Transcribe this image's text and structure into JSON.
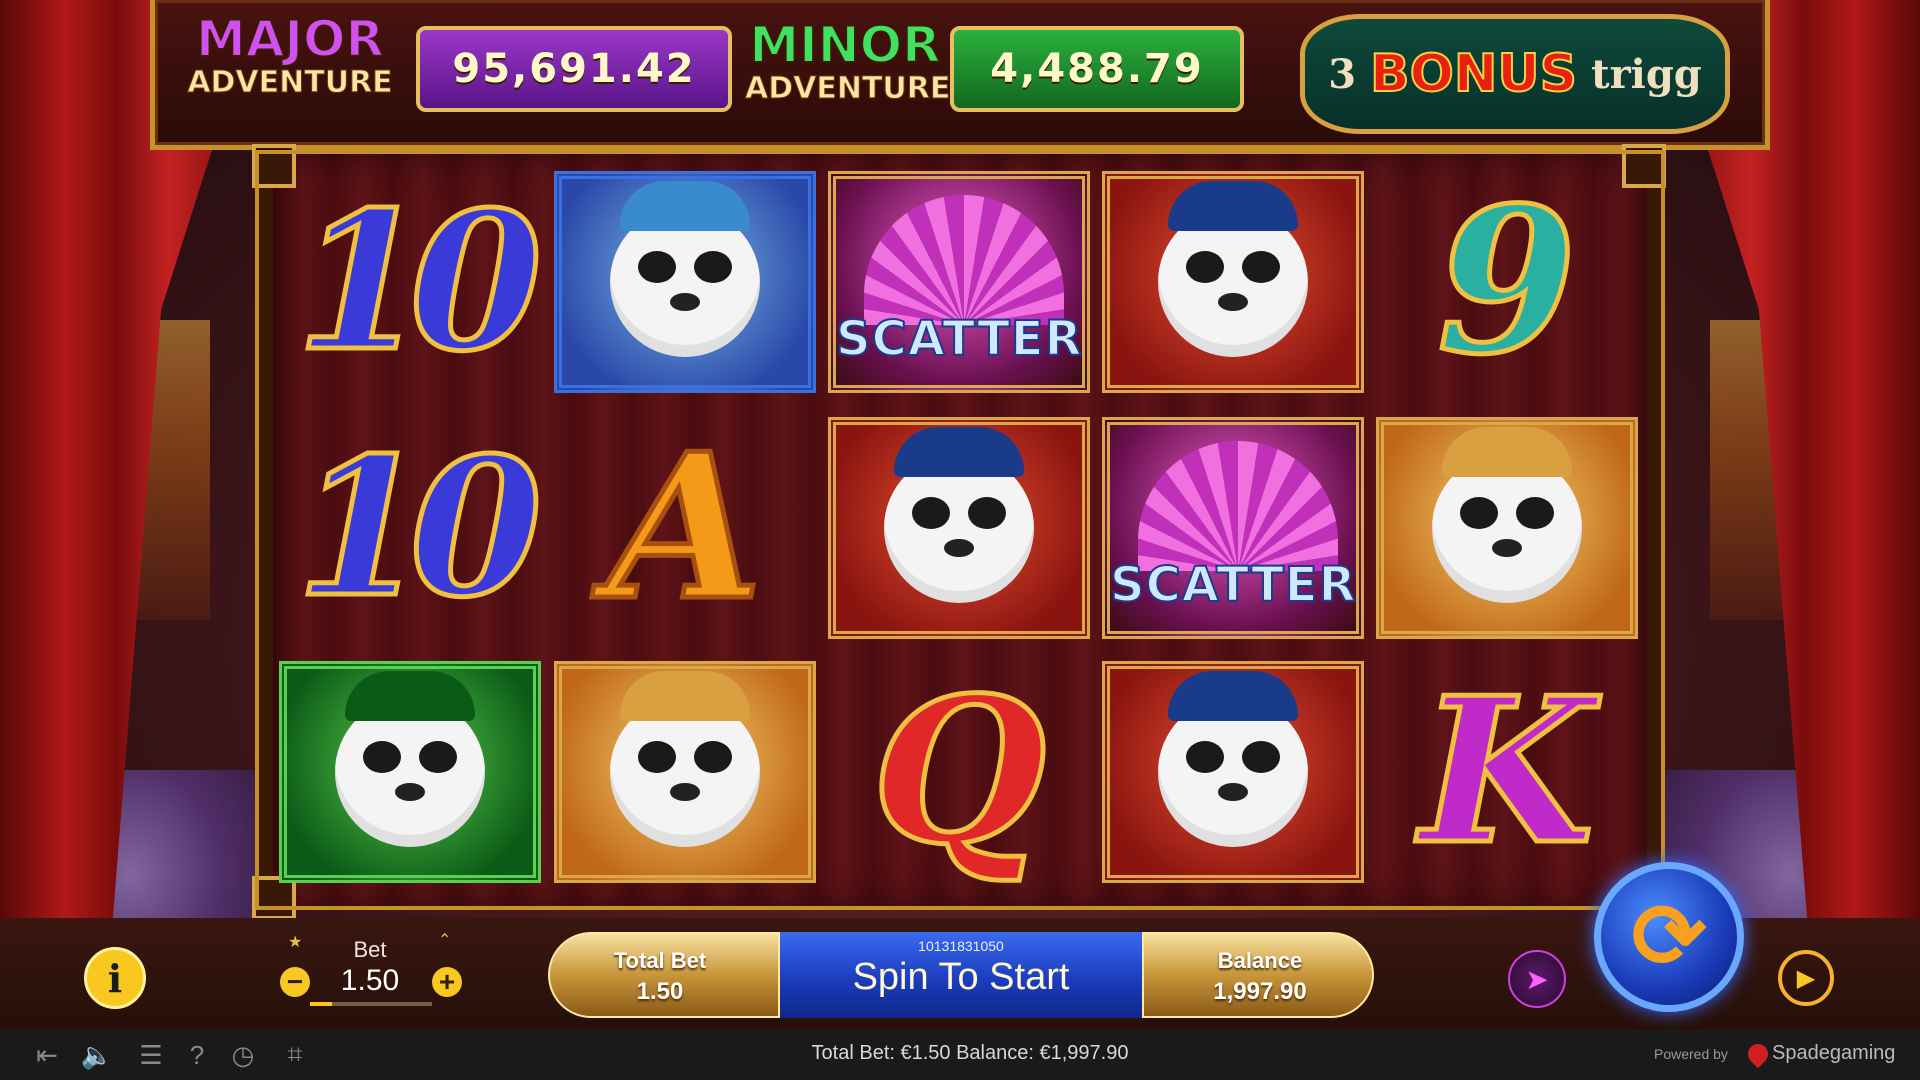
{
  "jackpots": {
    "major": {
      "title": "MAJOR",
      "subtitle": "ADVENTURE",
      "value": "95,691.42"
    },
    "minor": {
      "title": "MINOR",
      "subtitle": "ADVENTURE",
      "value": "4,488.79"
    }
  },
  "bonus_banner": {
    "count": "3",
    "word": "BONUS",
    "trail": "trigg"
  },
  "reels": [
    [
      {
        "symbol": "10",
        "kind": "glyph"
      },
      {
        "symbol": "blue-panda",
        "kind": "tile"
      },
      {
        "symbol": "SCATTER",
        "kind": "scatter"
      },
      {
        "symbol": "red-panda",
        "kind": "tile"
      },
      {
        "symbol": "9",
        "kind": "glyph"
      }
    ],
    [
      {
        "symbol": "10",
        "kind": "glyph"
      },
      {
        "symbol": "A",
        "kind": "glyph"
      },
      {
        "symbol": "red-panda",
        "kind": "tile"
      },
      {
        "symbol": "SCATTER",
        "kind": "scatter"
      },
      {
        "symbol": "gold-panda",
        "kind": "tile"
      }
    ],
    [
      {
        "symbol": "green-panda",
        "kind": "tile"
      },
      {
        "symbol": "gold-panda",
        "kind": "tile"
      },
      {
        "symbol": "Q",
        "kind": "glyph"
      },
      {
        "symbol": "red-panda",
        "kind": "tile"
      },
      {
        "symbol": "K",
        "kind": "glyph"
      }
    ]
  ],
  "controls": {
    "bet_label": "Bet",
    "bet_value": "1.50",
    "bet_level_fraction": 0.18,
    "total_bet_label": "Total Bet",
    "total_bet_value": "1.50",
    "round_id": "10131831050",
    "spin_label": "Spin To Start",
    "balance_label": "Balance",
    "balance_value": "1,997.90"
  },
  "footer": {
    "status": "Total Bet: €1.50  Balance: €1,997.90",
    "powered_by": "Powered by",
    "brand": "Spadegaming",
    "icons": [
      "exit-icon",
      "sound-icon",
      "menu-icon",
      "help-icon",
      "history-icon",
      "fullscreen-icon"
    ]
  },
  "colors": {
    "gold": "#c8902a",
    "major_purple": "#9a38c8",
    "minor_green": "#2cb03c",
    "spin_blue": "#1a3ab8",
    "accent_yellow": "#f8c820"
  }
}
